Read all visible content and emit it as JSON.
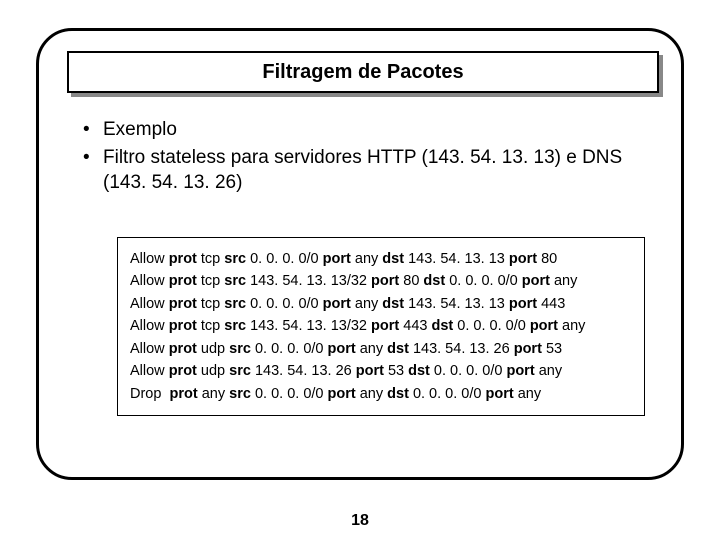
{
  "title": "Filtragem de Pacotes",
  "bullets": [
    "Exemplo",
    "Filtro stateless para servidores HTTP (143. 54. 13. 13) e DNS (143. 54. 13. 26)"
  ],
  "rule_keywords": {
    "prot": "prot",
    "src": "src",
    "port": "port",
    "dst": "dst"
  },
  "rules": [
    {
      "action": "Allow",
      "prot": "tcp",
      "src": "0. 0. 0. 0/0",
      "sport": "any",
      "dst": "143. 54. 13. 13",
      "dport": "80"
    },
    {
      "action": "Allow",
      "prot": "tcp",
      "src": "143. 54. 13. 13/32",
      "sport": "80",
      "dst": "0. 0. 0. 0/0",
      "dport": "any"
    },
    {
      "action": "Allow",
      "prot": "tcp",
      "src": "0. 0. 0. 0/0",
      "sport": "any",
      "dst": "143. 54. 13. 13",
      "dport": "443"
    },
    {
      "action": "Allow",
      "prot": "tcp",
      "src": "143. 54. 13. 13/32",
      "sport": "443",
      "dst": "0. 0. 0. 0/0",
      "dport": "any"
    },
    {
      "action": "Allow",
      "prot": "udp",
      "src": "0. 0. 0. 0/0",
      "sport": "any",
      "dst": "143. 54. 13. 26",
      "dport": "53"
    },
    {
      "action": "Allow",
      "prot": "udp",
      "src": "143. 54. 13. 26",
      "sport": "53",
      "dst": "0. 0. 0. 0/0",
      "dport": "any"
    },
    {
      "action": "Drop",
      "prot": "any",
      "src": "0. 0. 0. 0/0 ",
      "sport": "any",
      "dst": "0. 0. 0. 0/0",
      "dport": "any"
    }
  ],
  "page_number": "18"
}
